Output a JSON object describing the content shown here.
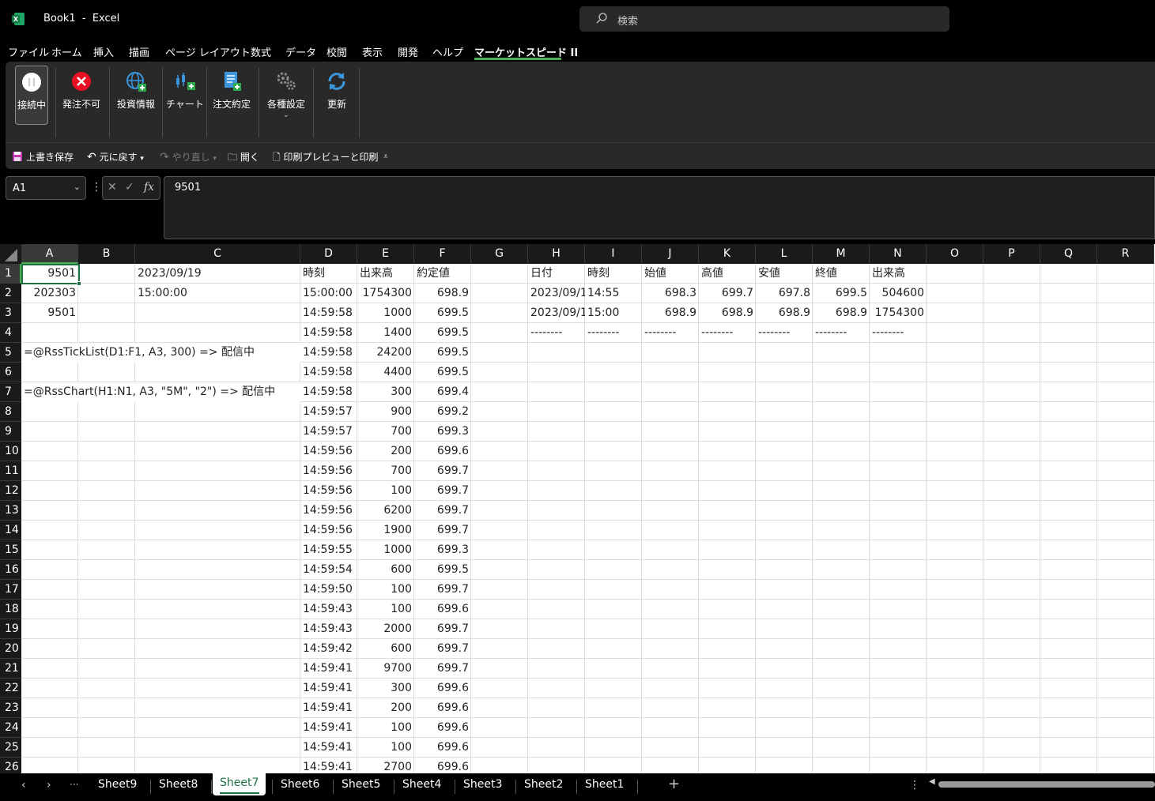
{
  "window": {
    "title": "Book1  -  Excel"
  },
  "search": {
    "placeholder": "検索"
  },
  "menu_tabs": [
    "ファイル",
    "ホーム",
    "挿入",
    "描画",
    "ページ レイアウト",
    "数式",
    "データ",
    "校閲",
    "表示",
    "開発",
    "ヘルプ",
    "マーケットスピード II"
  ],
  "active_tab": "マーケットスピード II",
  "ribbon": {
    "buttons": [
      {
        "label": "接続中",
        "icon": "connection-status-icon"
      },
      {
        "label": "発注不可",
        "icon": "error-x-icon"
      },
      {
        "label": "投資情報",
        "icon": "globe-add-icon"
      },
      {
        "label": "チャート",
        "icon": "chart-add-icon"
      },
      {
        "label": "注文約定",
        "icon": "order-document-icon"
      },
      {
        "label": "各種設定",
        "icon": "gears-icon"
      },
      {
        "label": "更新",
        "icon": "refresh-icon"
      }
    ]
  },
  "quick_access": {
    "save": "上書き保存",
    "undo": "元に戻す",
    "redo": "やり直し",
    "open": "開く",
    "print": "印刷プレビューと印刷"
  },
  "formula_bar": {
    "name_box": "A1",
    "formula": "9501",
    "fx_label": "fx"
  },
  "columns": [
    "A",
    "B",
    "C",
    "D",
    "E",
    "F",
    "G",
    "H",
    "I",
    "J",
    "K",
    "L",
    "M",
    "N",
    "O",
    "P",
    "Q",
    "R"
  ],
  "rows": [
    "1",
    "2",
    "3",
    "4",
    "5",
    "6",
    "7",
    "8",
    "9",
    "10",
    "11",
    "12",
    "13",
    "14",
    "15",
    "16",
    "17",
    "18",
    "19",
    "20",
    "21",
    "22",
    "23",
    "24",
    "25",
    "26"
  ],
  "cells": {
    "A1": "9501",
    "C1": "2023/09/19",
    "A2": "202303",
    "C2": "15:00:00",
    "A3": "9501",
    "A5": "=@RssTickList(D1:F1, A3, 300) => 配信中",
    "A7": "=@RssChart(H1:N1, A3, \"5M\", \"2\") => 配信中"
  },
  "tick_table": {
    "headers": [
      "時刻",
      "出来高",
      "約定値"
    ],
    "rows": [
      [
        "15:00:00",
        "1754300",
        "698.9"
      ],
      [
        "14:59:58",
        "1000",
        "699.5"
      ],
      [
        "14:59:58",
        "1400",
        "699.5"
      ],
      [
        "14:59:58",
        "24200",
        "699.5"
      ],
      [
        "14:59:58",
        "4400",
        "699.5"
      ],
      [
        "14:59:58",
        "300",
        "699.4"
      ],
      [
        "14:59:57",
        "900",
        "699.2"
      ],
      [
        "14:59:57",
        "700",
        "699.3"
      ],
      [
        "14:59:56",
        "200",
        "699.6"
      ],
      [
        "14:59:56",
        "700",
        "699.7"
      ],
      [
        "14:59:56",
        "100",
        "699.7"
      ],
      [
        "14:59:56",
        "6200",
        "699.7"
      ],
      [
        "14:59:56",
        "1900",
        "699.7"
      ],
      [
        "14:59:55",
        "1000",
        "699.3"
      ],
      [
        "14:59:54",
        "600",
        "699.5"
      ],
      [
        "14:59:50",
        "100",
        "699.7"
      ],
      [
        "14:59:43",
        "100",
        "699.6"
      ],
      [
        "14:59:43",
        "2000",
        "699.7"
      ],
      [
        "14:59:42",
        "600",
        "699.7"
      ],
      [
        "14:59:41",
        "9700",
        "699.7"
      ],
      [
        "14:59:41",
        "300",
        "699.6"
      ],
      [
        "14:59:41",
        "200",
        "699.6"
      ],
      [
        "14:59:41",
        "100",
        "699.6"
      ],
      [
        "14:59:41",
        "100",
        "699.6"
      ],
      [
        "14:59:41",
        "2700",
        "699.6"
      ]
    ]
  },
  "chart_table": {
    "headers": [
      "日付",
      "時刻",
      "始値",
      "高値",
      "安値",
      "終値",
      "出来高"
    ],
    "rows": [
      [
        "2023/09/1",
        "14:55",
        "698.3",
        "699.7",
        "697.8",
        "699.5",
        "504600"
      ],
      [
        "2023/09/1",
        "15:00",
        "698.9",
        "698.9",
        "698.9",
        "698.9",
        "1754300"
      ],
      [
        "--------",
        "--------",
        "--------",
        "--------",
        "--------",
        "--------",
        "--------"
      ]
    ]
  },
  "sheet_tabs": [
    "Sheet9",
    "Sheet8",
    "Sheet7",
    "Sheet6",
    "Sheet5",
    "Sheet4",
    "Sheet3",
    "Sheet2",
    "Sheet1"
  ],
  "active_sheet": "Sheet7",
  "sheet_nav": {
    "more": "···",
    "add": "+"
  },
  "colors": {
    "accent": "#1e7145",
    "tab_underline": "#4caf50",
    "grid_line": "#dcdcdc"
  }
}
